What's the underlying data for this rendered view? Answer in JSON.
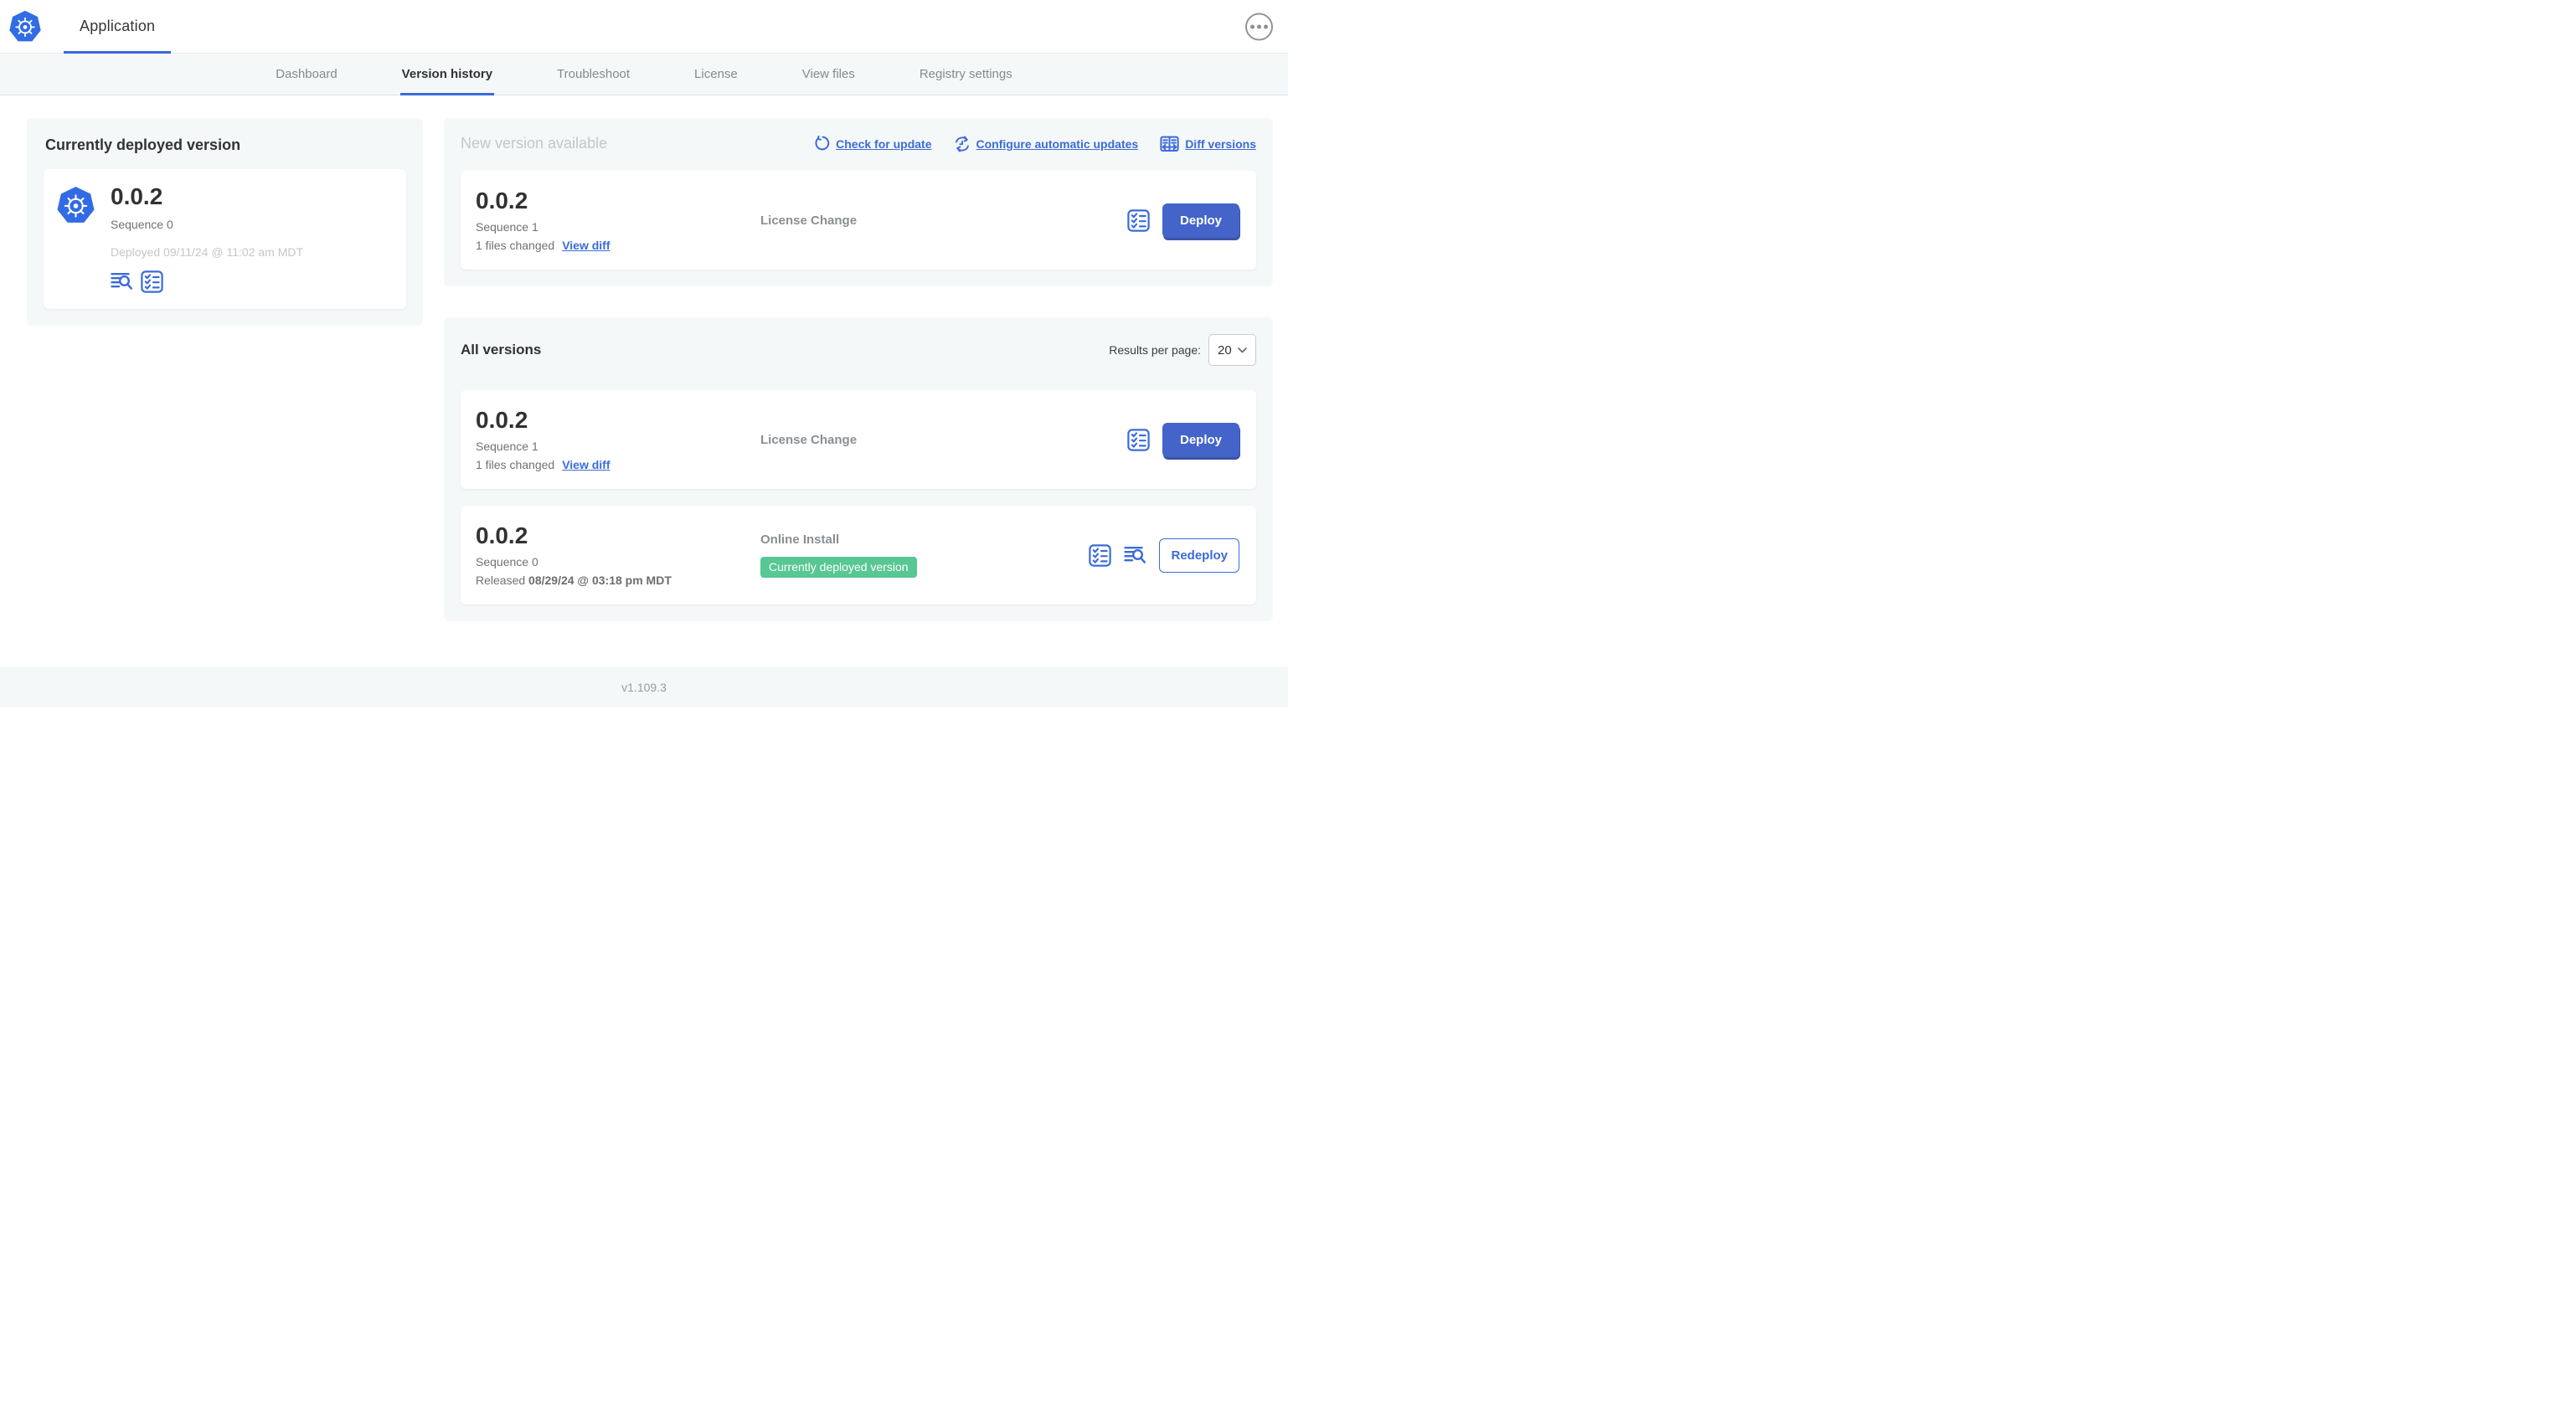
{
  "header": {
    "app_title": "Application"
  },
  "nav": {
    "tabs": [
      {
        "label": "Dashboard"
      },
      {
        "label": "Version history"
      },
      {
        "label": "Troubleshoot"
      },
      {
        "label": "License"
      },
      {
        "label": "View files"
      },
      {
        "label": "Registry settings"
      }
    ],
    "active_tab": "Version history"
  },
  "deployed_card": {
    "heading": "Currently deployed version",
    "version": "0.0.2",
    "sequence": "Sequence 0",
    "deployed_at": "Deployed 09/11/24 @ 11:02 am MDT",
    "icons": [
      "view-logs-icon",
      "preflight-checklist-icon"
    ]
  },
  "new_version": {
    "heading": "New version available",
    "actions": {
      "check_for_update": "Check for update",
      "configure_automatic_updates": "Configure automatic updates",
      "diff_versions": "Diff versions"
    },
    "row": {
      "version": "0.0.2",
      "sequence": "Sequence 1",
      "files_changed": "1 files changed",
      "view_diff": "View diff",
      "source": "License Change",
      "action": "Deploy"
    }
  },
  "all_versions": {
    "heading": "All versions",
    "results_per_page_label": "Results per page:",
    "results_per_page_value": "20",
    "rows": [
      {
        "version": "0.0.2",
        "sequence": "Sequence 1",
        "files_changed": "1 files changed",
        "view_diff": "View diff",
        "source": "License Change",
        "action": "Deploy"
      },
      {
        "version": "0.0.2",
        "sequence": "Sequence 0",
        "released_label": "Released",
        "released_date": "08/29/24 @ 03:18 pm MDT",
        "source": "Online Install",
        "badge": "Currently deployed version",
        "action": "Redeploy"
      }
    ]
  },
  "footer": {
    "version": "v1.109.3"
  },
  "colors": {
    "accent_blue": "#3b6bd8",
    "button_blue": "#4464c9",
    "kubernetes_blue": "#326ce5",
    "badge_green": "#57c793",
    "panel_bg": "#f5f8f9",
    "text_dark": "#323232",
    "text_gray": "#717171",
    "text_muted": "#c3c7ca"
  }
}
